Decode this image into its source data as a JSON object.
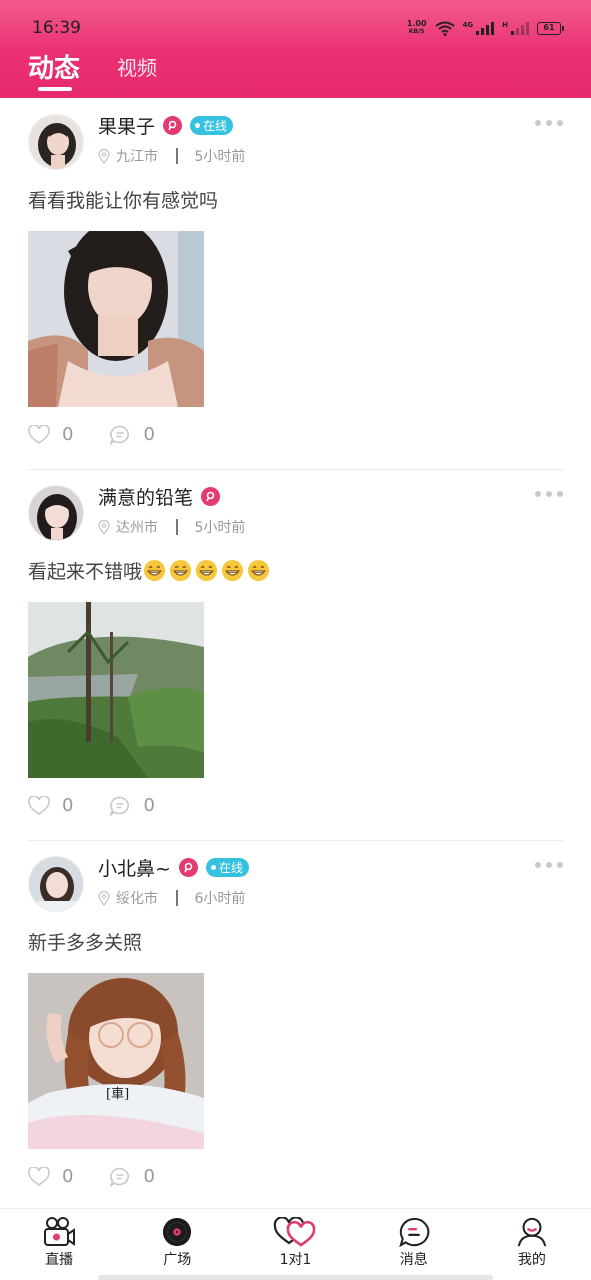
{
  "status_bar": {
    "time": "16:39",
    "net_speed_value": "1.00",
    "net_speed_unit": "KB/S",
    "signal_1_label": "4G",
    "signal_2_label": "H",
    "battery": "61"
  },
  "header": {
    "tabs": [
      {
        "label": "动态",
        "active": true
      },
      {
        "label": "视频",
        "active": false
      }
    ],
    "accent_color": "#e62a6d"
  },
  "posts": [
    {
      "nickname": "果果子",
      "online_label": "在线",
      "city": "九江市",
      "time": "5小时前",
      "text": "看看我能让你有感觉吗",
      "emoji_count": 0,
      "likes": "0",
      "comments": "0"
    },
    {
      "nickname": "满意的铅笔",
      "online_label": "",
      "city": "达州市",
      "time": "5小时前",
      "text": "看起来不错哦",
      "emoji_count": 5,
      "likes": "0",
      "comments": "0"
    },
    {
      "nickname": "小北鼻~",
      "online_label": "在线",
      "city": "绥化市",
      "time": "6小时前",
      "text": "新手多多关照",
      "emoji_count": 0,
      "likes": "0",
      "comments": "0",
      "photo_text": "[車]"
    }
  ],
  "bottom_nav": [
    {
      "label": "直播",
      "icon": "live-camera-icon"
    },
    {
      "label": "广场",
      "icon": "vinyl-record-icon",
      "active": true
    },
    {
      "label": "1对1",
      "icon": "double-heart-icon"
    },
    {
      "label": "消息",
      "icon": "message-bubble-icon"
    },
    {
      "label": "我的",
      "icon": "profile-icon"
    }
  ]
}
